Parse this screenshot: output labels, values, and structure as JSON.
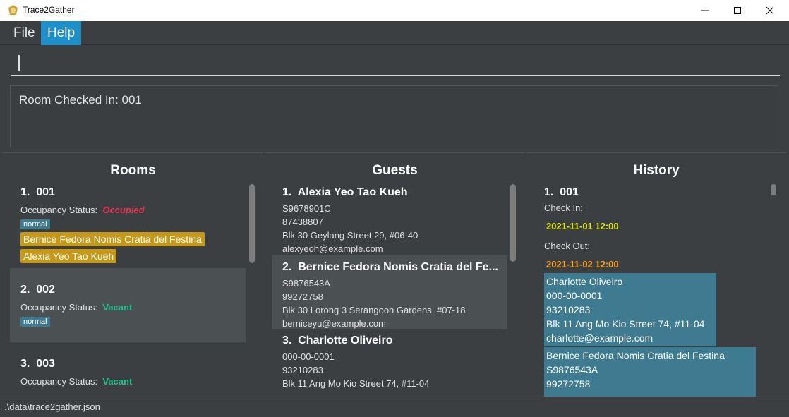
{
  "window": {
    "title": "Trace2Gather"
  },
  "menu": {
    "file": "File",
    "help": "Help"
  },
  "command": {
    "value": ""
  },
  "result": {
    "text": "Room Checked In: 001"
  },
  "rooms": {
    "title": "Rooms",
    "items": [
      {
        "index": "1.",
        "number": "001",
        "status_label": "Occupancy Status:",
        "status": "Occupied",
        "tag": "normal",
        "guests": [
          "Bernice Fedora Nomis Cratia del Festina",
          "Alexia Yeo Tao Kueh"
        ]
      },
      {
        "index": "2.",
        "number": "002",
        "status_label": "Occupancy Status:",
        "status": "Vacant",
        "tag": "normal"
      },
      {
        "index": "3.",
        "number": "003",
        "status_label": "Occupancy Status:",
        "status": "Vacant"
      }
    ]
  },
  "guests": {
    "title": "Guests",
    "items": [
      {
        "index": "1.",
        "name": "Alexia Yeo Tao Kueh",
        "passport": "S9678901C",
        "phone": "87438807",
        "address": "Blk 30 Geylang Street 29, #06-40",
        "email": "alexyeoh@example.com"
      },
      {
        "index": "2.",
        "name": "Bernice Fedora Nomis Cratia del Fe...",
        "passport": "S9876543A",
        "phone": "99272758",
        "address": "Blk 30 Lorong 3 Serangoon Gardens, #07-18",
        "email": "berniceyu@example.com"
      },
      {
        "index": "3.",
        "name": "Charlotte Oliveiro",
        "passport": "000-00-0001",
        "phone": "93210283",
        "address": "Blk 11 Ang Mo Kio Street 74, #11-04"
      }
    ]
  },
  "history": {
    "title": "History",
    "item": {
      "index": "1.",
      "number": "001",
      "check_in_label": "Check In:",
      "check_in": "2021-11-01 12:00",
      "check_out_label": "Check Out:",
      "check_out": "2021-11-02 12:00",
      "guest1": {
        "name": "Charlotte Oliveiro",
        "passport": "000-00-0001",
        "phone": "93210283",
        "address": "Blk 11 Ang Mo Kio Street 74, #11-04",
        "email": "charlotte@example.com"
      },
      "guest2": {
        "name": "Bernice Fedora Nomis Cratia del Festina",
        "passport": "S9876543A",
        "phone": "99272758"
      }
    }
  },
  "statusbar": {
    "path": ".\\data\\trace2gather.json"
  },
  "colors": {
    "accent": "#1f8fc9",
    "occupied": "#e53452",
    "vacant": "#26c08a",
    "guest_tag": "#c59817",
    "normal_tag": "#3e7b91",
    "check_in": "#d8e21c",
    "check_out": "#f3a22a"
  }
}
